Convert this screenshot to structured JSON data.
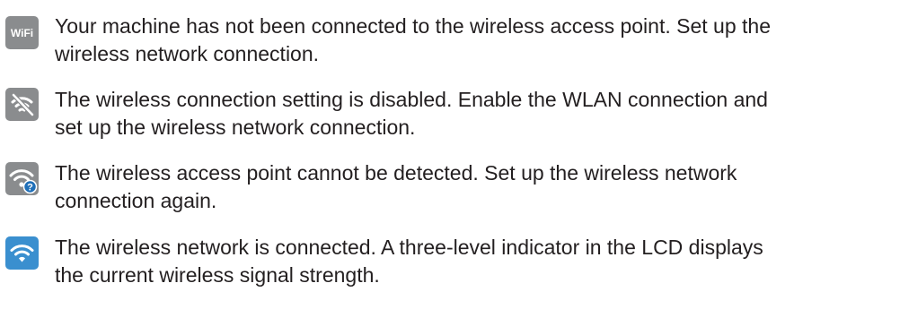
{
  "status_items": [
    {
      "icon": "wifi-text-icon",
      "icon_label": "WiFi",
      "icon_color": "#8a8c8e",
      "lines": [
        "Your machine has not been connected to the wireless access point. Set up the",
        "wireless network connection."
      ]
    },
    {
      "icon": "wifi-disabled-icon",
      "icon_color": "#8a8c8e",
      "lines": [
        "The wireless connection setting is disabled. Enable the WLAN connection and",
        "set up the wireless network connection."
      ]
    },
    {
      "icon": "wifi-question-icon",
      "icon_color": "#8a8c8e",
      "badge_color": "#1f6fb8",
      "lines": [
        "The wireless access point cannot be detected. Set up the wireless network",
        "connection again."
      ]
    },
    {
      "icon": "wifi-connected-icon",
      "icon_color": "#3a8fcf",
      "lines": [
        "The wireless network is connected. A three-level indicator in the LCD displays",
        "the current wireless signal strength."
      ]
    }
  ]
}
